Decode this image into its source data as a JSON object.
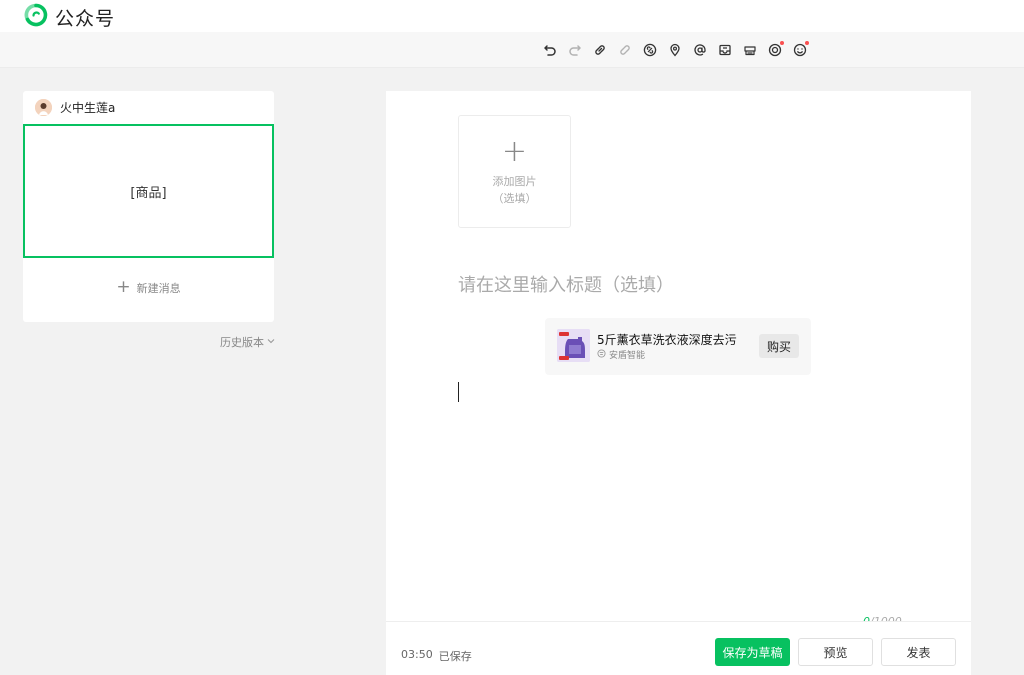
{
  "app": {
    "name": "公众号",
    "brand_color": "#07c160"
  },
  "toolbar": {
    "icons": [
      {
        "name": "undo-icon",
        "disabled": false
      },
      {
        "name": "redo-icon",
        "disabled": true
      },
      {
        "name": "link-icon",
        "disabled": false
      },
      {
        "name": "unlink-icon",
        "disabled": true
      },
      {
        "name": "mini-program-icon",
        "disabled": false
      },
      {
        "name": "location-icon",
        "disabled": false
      },
      {
        "name": "at-mention-icon",
        "disabled": false
      },
      {
        "name": "inbox-icon",
        "disabled": false
      },
      {
        "name": "shop-icon",
        "disabled": false
      },
      {
        "name": "target-icon",
        "disabled": false,
        "badge": true
      },
      {
        "name": "emoji-icon",
        "disabled": false,
        "badge": true
      }
    ]
  },
  "sidebar": {
    "author": "火中生莲a",
    "message_title": "[商品]",
    "new_message_label": "新建消息",
    "history_label": "历史版本"
  },
  "editor": {
    "add_image_line1": "添加图片",
    "add_image_line2": "（选填）",
    "title_placeholder": "请在这里输入标题（选填）",
    "product": {
      "name": "5斤薰衣草洗衣液深度去污",
      "shop": "安盾智能",
      "buy_label": "购买"
    },
    "counter_current": "0",
    "counter_max": "/1000"
  },
  "footer": {
    "time": "03:50",
    "status": "已保存",
    "save_draft_label": "保存为草稿",
    "preview_label": "预览",
    "publish_label": "发表"
  }
}
